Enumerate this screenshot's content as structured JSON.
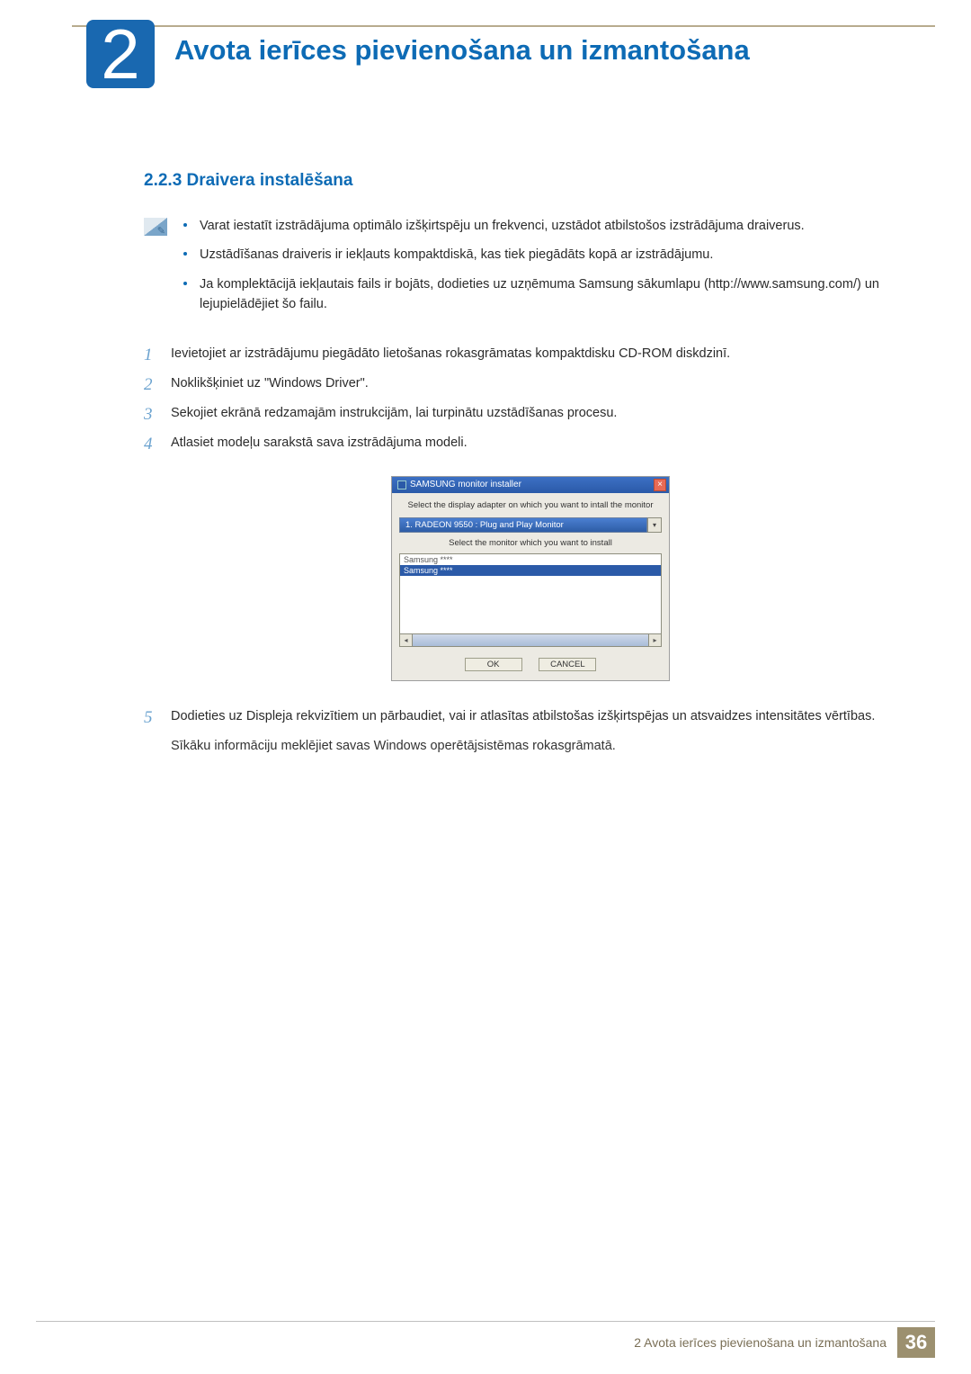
{
  "chapter": {
    "number": "2",
    "title": "Avota ierīces pievienošana un izmantošana"
  },
  "section": {
    "number": "2.2.3",
    "title": "Draivera instalēšana"
  },
  "notes": [
    "Varat iestatīt izstrādājuma optimālo izšķirtspēju un frekvenci, uzstādot atbilstošos izstrādājuma draiverus.",
    "Uzstādīšanas draiveris ir iekļauts kompaktdiskā, kas tiek piegādāts kopā ar izstrādājumu.",
    "Ja komplektācijā iekļautais fails ir bojāts, dodieties uz uzņēmuma Samsung sākumlapu (http://www.samsung.com/) un lejupielādējiet šo failu."
  ],
  "steps": [
    "Ievietojiet ar izstrādājumu piegādāto lietošanas rokasgrāmatas kompaktdisku CD-ROM diskdzinī.",
    "Noklikšķiniet uz \"Windows Driver\".",
    "Sekojiet ekrānā redzamajām instrukcijām, lai turpinātu uzstādīšanas procesu.",
    "Atlasiet modeļu sarakstā sava izstrādājuma modeli."
  ],
  "installer": {
    "title": "SAMSUNG monitor installer",
    "label1": "Select the display adapter on which you want to intall the monitor",
    "combo": "1. RADEON 9550 : Plug and Play Monitor",
    "label2": "Select the monitor which you want to install",
    "item1": "Samsung ****",
    "item2": "Samsung ****",
    "ok": "OK",
    "cancel": "CANCEL"
  },
  "step5": {
    "num": "5",
    "text": "Dodieties uz Displeja rekvizītiem un pārbaudiet, vai ir atlasītas atbilstošas izšķirtspējas un atsvaidzes intensitātes vērtības.",
    "para": "Sīkāku informāciju meklējiet savas Windows operētājsistēmas rokasgrāmatā."
  },
  "footer": {
    "text": "2 Avota ierīces pievienošana un izmantošana",
    "page": "36"
  }
}
